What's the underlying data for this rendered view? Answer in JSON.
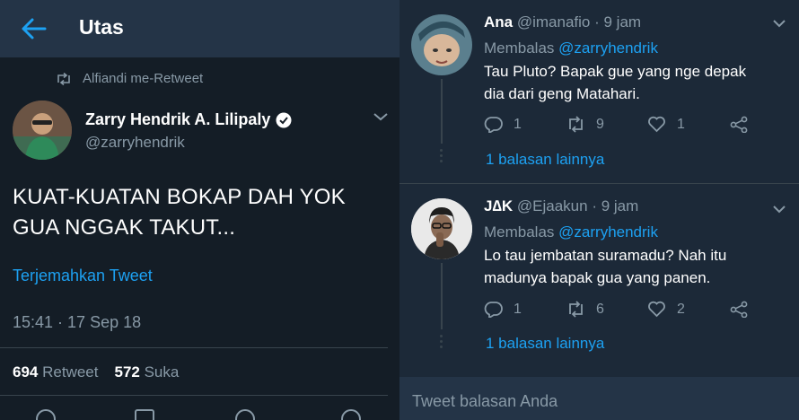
{
  "colors": {
    "background": "#141d26",
    "panel": "#1c2938",
    "header": "#243447",
    "accent": "#1da1f2",
    "muted": "#8899a6"
  },
  "header": {
    "title": "Utas",
    "back_icon": "arrow-left-icon"
  },
  "retweet_context": {
    "text": "Alfiandi me-Retweet",
    "icon": "retweet-icon"
  },
  "tweet": {
    "author_name": "Zarry Hendrik A. Lilipaly",
    "author_handle": "@zarryhendrik",
    "verified_icon": "verified-badge-icon",
    "text_line1": "KUAT-KUATAN BOKAP DAH YOK",
    "text_line2": "GUA NGGAK TAKUT...",
    "translate_label": "Terjemahkan Tweet",
    "timestamp": "15:41 · 17 Sep 18",
    "retweet_count": "694",
    "retweet_label": "Retweet",
    "like_count": "572",
    "like_label": "Suka"
  },
  "replies": [
    {
      "name": "Ana",
      "handle": "@imanafio",
      "time": "· 9 jam",
      "replying_prefix": "Membalas",
      "replying_to": "@zarryhendrik",
      "text_line1": "Tau Pluto? Bapak gue yang nge depak",
      "text_line2": "dia dari geng Matahari.",
      "reply_count": "1",
      "retweet_count": "9",
      "like_count": "1",
      "more_replies": "1 balasan lainnya"
    },
    {
      "name": "J∆K",
      "handle": "@Ejaakun",
      "time": "· 9 jam",
      "replying_prefix": "Membalas",
      "replying_to": "@zarryhendrik",
      "text_line1": "Lo tau jembatan suramadu? Nah itu",
      "text_line2": "madunya bapak gua yang panen.",
      "reply_count": "1",
      "retweet_count": "6",
      "like_count": "2",
      "more_replies": "1 balasan lainnya"
    }
  ],
  "reply_box": {
    "placeholder": "Tweet balasan Anda"
  }
}
